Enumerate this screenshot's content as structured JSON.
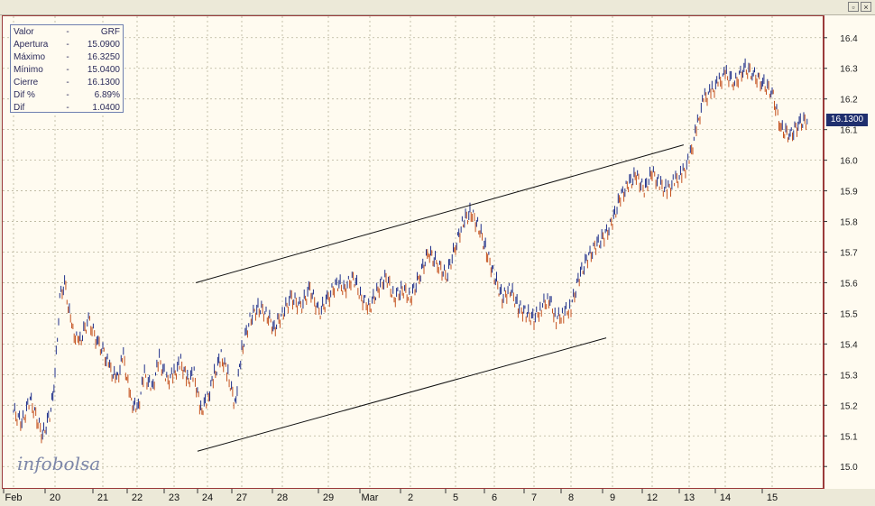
{
  "window": {
    "restore_icon": "restore-window-icon",
    "close_icon": "close-window-icon"
  },
  "legend": {
    "rows": [
      {
        "key": "Valor",
        "dash": "-",
        "value": "GRF"
      },
      {
        "key": "Apertura",
        "dash": "-",
        "value": "15.0900"
      },
      {
        "key": "Máximo",
        "dash": "-",
        "value": "16.3250"
      },
      {
        "key": "Mínimo",
        "dash": "-",
        "value": "15.0400"
      },
      {
        "key": "Cierre",
        "dash": "-",
        "value": "16.1300"
      },
      {
        "key": "Dif %",
        "dash": "-",
        "value": "6.89%"
      },
      {
        "key": "Dif",
        "dash": "-",
        "value": "1.0400"
      }
    ]
  },
  "brand": {
    "text": "infobolsa"
  },
  "last_price_label": "16.1300",
  "colors": {
    "up": "#1f2f8a",
    "down": "#c4521f",
    "grid": "#b8b29a",
    "frame": "#9b3a3a",
    "trend": "#111111",
    "last_box": "#1f2f6e"
  },
  "chart_data": {
    "type": "line",
    "symbol": "GRF",
    "ylim": [
      14.93,
      16.47
    ],
    "y_ticks": [
      15.0,
      15.1,
      15.2,
      15.3,
      15.4,
      15.5,
      15.6,
      15.7,
      15.8,
      15.9,
      16.0,
      16.1,
      16.2,
      16.3,
      16.4
    ],
    "x_labels": [
      "Feb",
      "20",
      "21",
      "22",
      "23",
      "24",
      "27",
      "28",
      "29",
      "Mar",
      "2",
      "5",
      "6",
      "7",
      "8",
      "9",
      "12",
      "13",
      "14",
      "15"
    ],
    "grid": true,
    "price_path": [
      [
        0,
        15.18
      ],
      [
        0.2,
        15.14
      ],
      [
        0.4,
        15.22
      ],
      [
        0.7,
        15.1
      ],
      [
        0.9,
        15.18
      ],
      [
        1.0,
        15.3
      ],
      [
        1.1,
        15.55
      ],
      [
        1.2,
        15.6
      ],
      [
        1.35,
        15.45
      ],
      [
        1.5,
        15.4
      ],
      [
        1.7,
        15.48
      ],
      [
        1.9,
        15.4
      ],
      [
        2.0,
        15.38
      ],
      [
        2.2,
        15.32
      ],
      [
        2.4,
        15.28
      ],
      [
        2.6,
        15.36
      ],
      [
        2.8,
        15.22
      ],
      [
        3.0,
        15.18
      ],
      [
        3.2,
        15.3
      ],
      [
        3.4,
        15.25
      ],
      [
        3.6,
        15.35
      ],
      [
        3.8,
        15.28
      ],
      [
        4.0,
        15.3
      ],
      [
        4.2,
        15.34
      ],
      [
        4.4,
        15.28
      ],
      [
        4.6,
        15.3
      ],
      [
        4.8,
        15.18
      ],
      [
        5.0,
        15.22
      ],
      [
        5.2,
        15.3
      ],
      [
        5.4,
        15.36
      ],
      [
        5.6,
        15.3
      ],
      [
        5.8,
        15.2
      ],
      [
        6.0,
        15.38
      ],
      [
        6.2,
        15.48
      ],
      [
        6.4,
        15.52
      ],
      [
        6.6,
        15.5
      ],
      [
        6.8,
        15.45
      ],
      [
        7.0,
        15.5
      ],
      [
        7.2,
        15.55
      ],
      [
        7.4,
        15.52
      ],
      [
        7.6,
        15.58
      ],
      [
        7.8,
        15.5
      ],
      [
        8.0,
        15.55
      ],
      [
        8.2,
        15.6
      ],
      [
        8.4,
        15.58
      ],
      [
        8.6,
        15.62
      ],
      [
        8.8,
        15.55
      ],
      [
        9.0,
        15.52
      ],
      [
        9.2,
        15.58
      ],
      [
        9.4,
        15.62
      ],
      [
        9.6,
        15.55
      ],
      [
        9.8,
        15.58
      ],
      [
        10.0,
        15.55
      ],
      [
        10.2,
        15.62
      ],
      [
        10.4,
        15.7
      ],
      [
        10.6,
        15.66
      ],
      [
        10.8,
        15.62
      ],
      [
        11.0,
        15.72
      ],
      [
        11.2,
        15.8
      ],
      [
        11.4,
        15.83
      ],
      [
        11.6,
        15.78
      ],
      [
        11.8,
        15.7
      ],
      [
        12.0,
        15.62
      ],
      [
        12.2,
        15.55
      ],
      [
        12.4,
        15.58
      ],
      [
        12.6,
        15.52
      ],
      [
        12.8,
        15.5
      ],
      [
        13.0,
        15.48
      ],
      [
        13.2,
        15.52
      ],
      [
        13.4,
        15.55
      ],
      [
        13.6,
        15.48
      ],
      [
        13.8,
        15.5
      ],
      [
        14.0,
        15.52
      ],
      [
        14.2,
        15.62
      ],
      [
        14.4,
        15.68
      ],
      [
        14.6,
        15.72
      ],
      [
        14.8,
        15.75
      ],
      [
        15.0,
        15.8
      ],
      [
        15.2,
        15.88
      ],
      [
        15.4,
        15.92
      ],
      [
        15.6,
        15.95
      ],
      [
        15.8,
        15.9
      ],
      [
        16.0,
        15.96
      ],
      [
        16.2,
        15.92
      ],
      [
        16.4,
        15.9
      ],
      [
        16.6,
        15.93
      ],
      [
        16.8,
        15.95
      ],
      [
        17.0,
        16.0
      ],
      [
        17.2,
        16.1
      ],
      [
        17.4,
        16.2
      ],
      [
        17.6,
        16.22
      ],
      [
        17.8,
        16.25
      ],
      [
        18.0,
        16.28
      ],
      [
        18.2,
        16.25
      ],
      [
        18.4,
        16.3
      ],
      [
        18.6,
        16.28
      ],
      [
        18.8,
        16.25
      ],
      [
        19.0,
        16.22
      ],
      [
        19.2,
        16.1
      ],
      [
        19.4,
        16.08
      ],
      [
        19.6,
        16.12
      ],
      [
        19.8,
        16.13
      ]
    ],
    "trendlines": [
      {
        "x": [
          4.65,
          16.85
        ],
        "y": [
          15.6,
          16.05
        ]
      },
      {
        "x": [
          4.7,
          14.85
        ],
        "y": [
          15.05,
          15.42
        ]
      }
    ],
    "last_value": 16.13
  }
}
